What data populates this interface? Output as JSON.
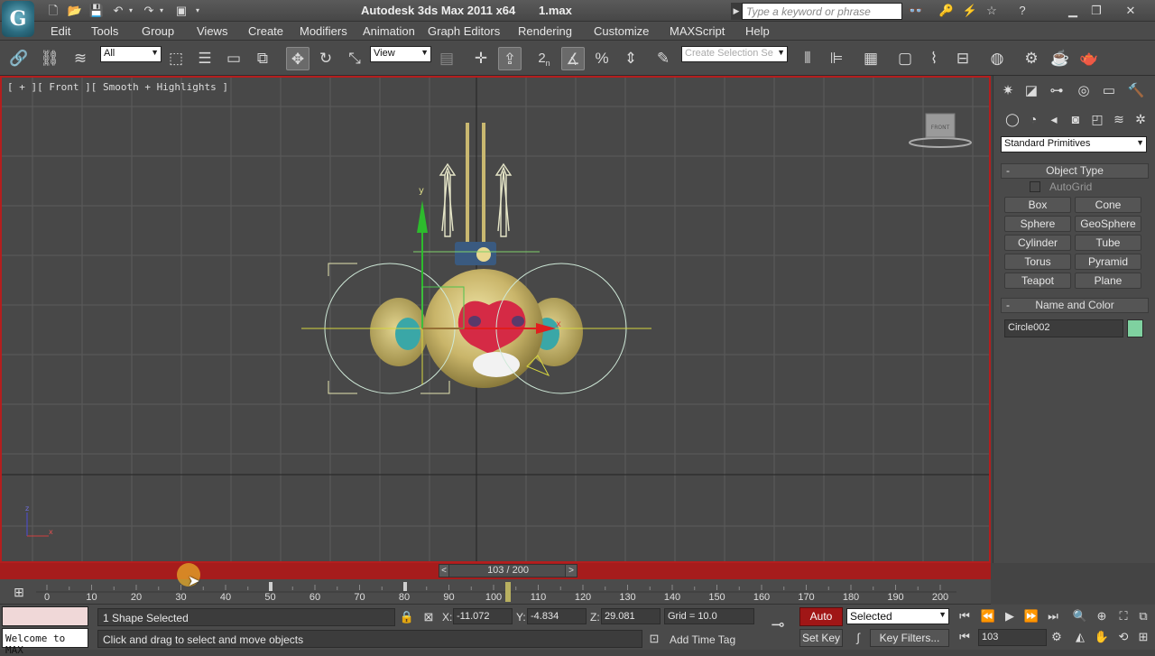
{
  "app": {
    "logo_letter": "G",
    "title": "Autodesk 3ds Max  2011 x64",
    "file_name": "1.max",
    "search_placeholder": "Type a keyword or phrase"
  },
  "menu": [
    "Edit",
    "Tools",
    "Group",
    "Views",
    "Create",
    "Modifiers",
    "Animation",
    "Graph Editors",
    "Rendering",
    "Customize",
    "MAXScript",
    "Help"
  ],
  "toolbar": {
    "selection_filter": "All",
    "reference_coord": "View",
    "snap_label": "2",
    "selection_set_placeholder": "Create Selection Se"
  },
  "viewport": {
    "label": "[ + ][ Front ][ Smooth + Highlights ]",
    "viewcube_label": "FRONT",
    "gizmo_y_label": "y",
    "gizmo_x_label": "x"
  },
  "command_panel": {
    "category_dropdown": "Standard Primitives",
    "object_type": {
      "title": "Object Type",
      "autogrid_label": "AutoGrid",
      "buttons": [
        "Box",
        "Cone",
        "Sphere",
        "GeoSphere",
        "Cylinder",
        "Tube",
        "Torus",
        "Pyramid",
        "Teapot",
        "Plane"
      ]
    },
    "name_and_color": {
      "title": "Name and Color",
      "object_name": "Circle002",
      "color": "#7fd1a0"
    }
  },
  "timeline": {
    "slider_text": "103 / 200",
    "prev_label": "<",
    "next_label": ">",
    "current_frame": 103,
    "ticks": [
      "0",
      "10",
      "20",
      "30",
      "40",
      "50",
      "60",
      "70",
      "80",
      "90",
      "100",
      "110",
      "120",
      "130",
      "140",
      "150",
      "160",
      "170",
      "180",
      "190",
      "200"
    ]
  },
  "status": {
    "maxscript_listener": "Welcome to MAX",
    "selection_info": "1 Shape Selected",
    "prompt": "Click and drag to select and move objects",
    "x_label": "X:",
    "x_value": "-11.072",
    "y_label": "Y:",
    "y_value": "-4.834",
    "z_label": "Z:",
    "z_value": "29.081",
    "grid": "Grid = 10.0",
    "add_time_tag": "Add Time Tag",
    "auto_key": "Auto Key",
    "set_key": "Set Key",
    "key_mode": "Selected",
    "key_filters": "Key Filters...",
    "frame_field": "103"
  },
  "colors": {
    "accent_red": "#b41e1e",
    "auto_key_bg": "#a01616"
  }
}
